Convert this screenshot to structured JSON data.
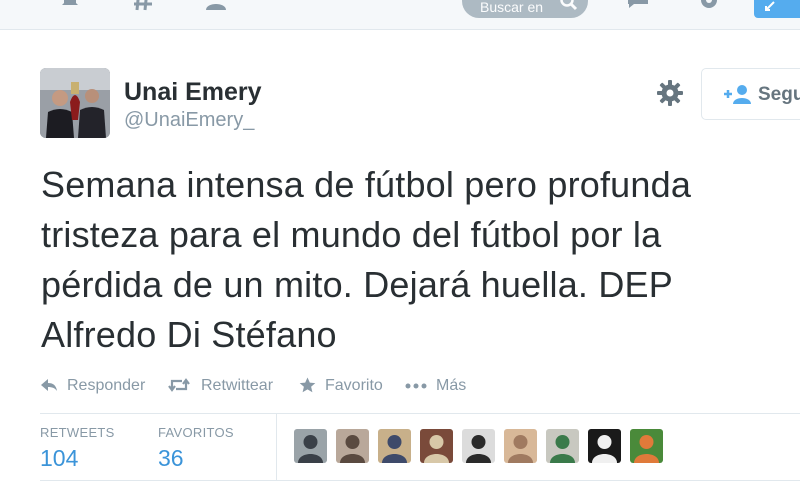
{
  "topbar": {
    "icons": [
      "bell-icon",
      "hashtag-icon",
      "person-icon",
      "bird-logo-icon",
      "messages-icon",
      "settings-icon",
      "compose-icon"
    ],
    "search_placeholder": "Buscar en",
    "colors": {
      "bar": "#f5f8fa",
      "search": "#8899a6",
      "compose": "#55acee"
    }
  },
  "profile": {
    "name": "Unai Emery",
    "handle": "@UnaiEmery_",
    "follow_label": "Seguir"
  },
  "tweet": {
    "text": "Semana intensa de fútbol pero profunda\ntristeza para el mundo del fútbol por la\npérdida de un mito. Dejará huella. DEP\nAlfredo Di Stéfano"
  },
  "actions": {
    "reply": "Responder",
    "retweet": "Retwittear",
    "favorite": "Favorito",
    "more": "Más"
  },
  "stats": {
    "retweets_label": "RETWEETS",
    "retweets_value": "104",
    "favorites_label": "FAVORITOS",
    "favorites_value": "36"
  },
  "favoriters": [
    {
      "name": "favoriter-avatar-1",
      "bg": "#9aa3a8",
      "fg": "#3a4048"
    },
    {
      "name": "favoriter-avatar-2",
      "bg": "#b9a89a",
      "fg": "#5a4a40"
    },
    {
      "name": "favoriter-avatar-3",
      "bg": "#c8b08a",
      "fg": "#3e4a6a"
    },
    {
      "name": "favoriter-avatar-4",
      "bg": "#7a4a3a",
      "fg": "#d8c8a8"
    },
    {
      "name": "favoriter-avatar-5",
      "bg": "#dcdcdc",
      "fg": "#2a2a2a"
    },
    {
      "name": "favoriter-avatar-6",
      "bg": "#d8b898",
      "fg": "#a07a60"
    },
    {
      "name": "favoriter-avatar-7",
      "bg": "#c8c8c0",
      "fg": "#3a7a4a"
    },
    {
      "name": "favoriter-avatar-8",
      "bg": "#1a1a1a",
      "fg": "#f0f0f0"
    },
    {
      "name": "favoriter-avatar-9",
      "bg": "#4a8a3a",
      "fg": "#e07a3a"
    }
  ]
}
